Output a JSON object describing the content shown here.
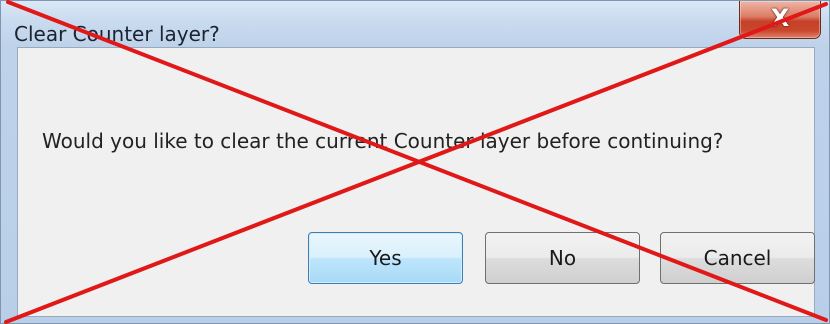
{
  "dialog": {
    "title": "Clear Counter layer?",
    "close_glyph": "X",
    "message": "Would you like to clear the current Counter layer before continuing?",
    "buttons": {
      "yes": "Yes",
      "no": "No",
      "cancel": "Cancel"
    }
  },
  "icons": {
    "close": "close-icon",
    "overlay": "red-x-cross-overlay"
  },
  "colors": {
    "overlay_red": "#e01818",
    "close_button_red": "#c54128",
    "default_button_border": "#3c7fb1"
  }
}
